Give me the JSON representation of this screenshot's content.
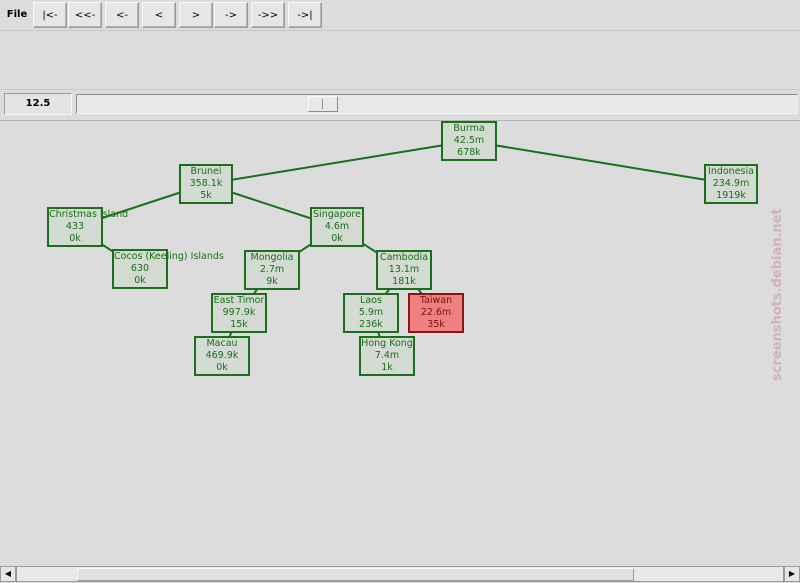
{
  "toolbar": {
    "file_label": "File",
    "nav_buttons": [
      "|<-",
      "<<-",
      "<-",
      "<",
      ">",
      "->",
      "->>",
      "->|"
    ]
  },
  "zoom": {
    "value": "12.5"
  },
  "colors": {
    "node_border": "#1b6e1b",
    "node_fill": "#d0d8d0",
    "selected_fill": "#f08080",
    "selected_border": "#8b1414"
  },
  "tree": {
    "nodes": [
      {
        "id": "burma",
        "name": "Burma",
        "l1": "42.5m",
        "l2": "678k",
        "parent": null
      },
      {
        "id": "brunei",
        "name": "Brunei",
        "l1": "358.1k",
        "l2": "5k",
        "parent": "burma"
      },
      {
        "id": "indonesia",
        "name": "Indonesia",
        "l1": "234.9m",
        "l2": "1919k",
        "parent": "burma"
      },
      {
        "id": "christmas",
        "name": "Christmas Island",
        "l1": "433",
        "l2": "0k",
        "parent": "brunei"
      },
      {
        "id": "cocos",
        "name": "Cocos (Keeling) Islands",
        "l1": "630",
        "l2": "0k",
        "parent": "christmas"
      },
      {
        "id": "singapore",
        "name": "Singapore",
        "l1": "4.6m",
        "l2": "0k",
        "parent": "brunei"
      },
      {
        "id": "mongolia",
        "name": "Mongolia",
        "l1": "2.7m",
        "l2": "9k",
        "parent": "singapore"
      },
      {
        "id": "cambodia",
        "name": "Cambodia",
        "l1": "13.1m",
        "l2": "181k",
        "parent": "singapore"
      },
      {
        "id": "easttimor",
        "name": "East Timor",
        "l1": "997.9k",
        "l2": "15k",
        "parent": "mongolia"
      },
      {
        "id": "macau",
        "name": "Macau",
        "l1": "469.9k",
        "l2": "0k",
        "parent": "easttimor"
      },
      {
        "id": "laos",
        "name": "Laos",
        "l1": "5.9m",
        "l2": "236k",
        "parent": "cambodia"
      },
      {
        "id": "taiwan",
        "name": "Taiwan",
        "l1": "22.6m",
        "l2": "35k",
        "parent": "cambodia",
        "selected": true
      },
      {
        "id": "hongkong",
        "name": "Hong Kong",
        "l1": "7.4m",
        "l2": "1k",
        "parent": "laos"
      }
    ]
  },
  "watermark": "screenshots.debian.net"
}
